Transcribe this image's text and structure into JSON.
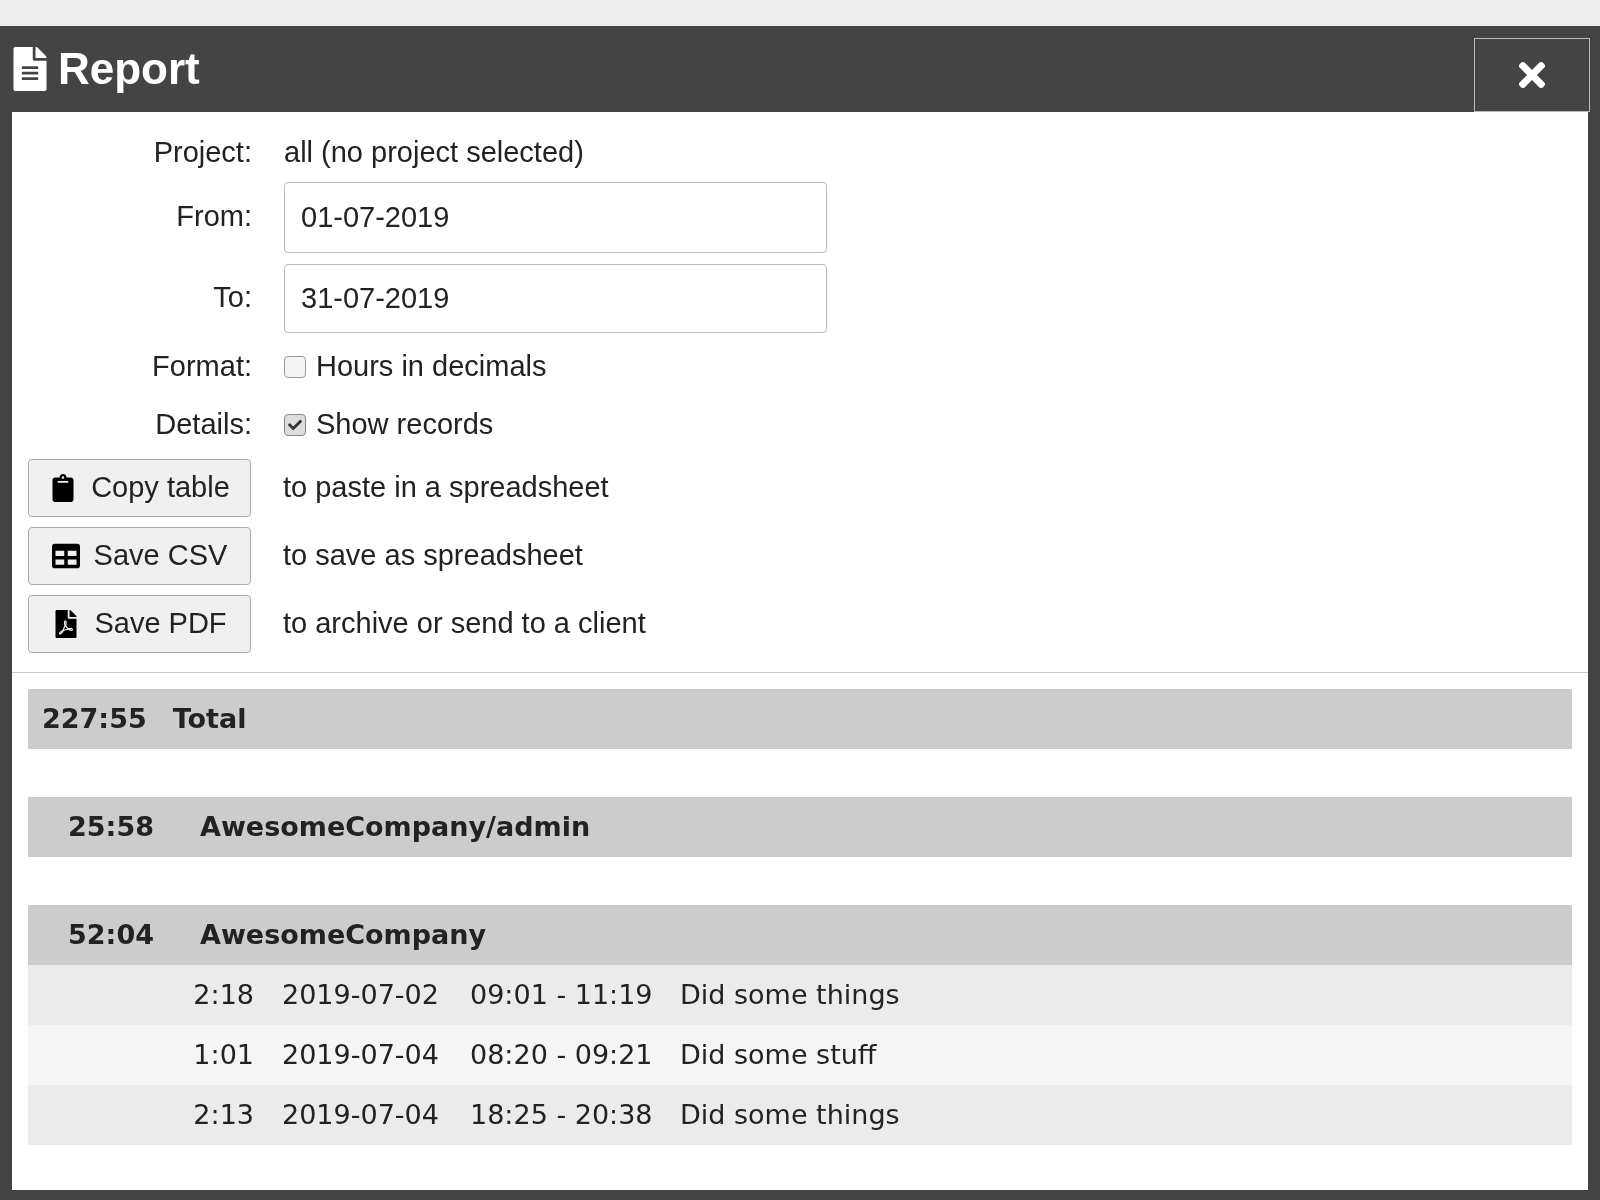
{
  "dialog": {
    "title": "Report"
  },
  "form": {
    "project": {
      "label": "Project:",
      "value": "all (no project selected)"
    },
    "from": {
      "label": "From:",
      "value": "01-07-2019"
    },
    "to": {
      "label": "To:",
      "value": "31-07-2019"
    },
    "format": {
      "label": "Format:",
      "option": "Hours in decimals",
      "checked": false
    },
    "details": {
      "label": "Details:",
      "option": "Show records",
      "checked": true
    }
  },
  "actions": [
    {
      "kind": "copy",
      "label": "Copy table",
      "description": "to paste in a spreadsheet"
    },
    {
      "kind": "csv",
      "label": "Save CSV",
      "description": "to save as spreadsheet"
    },
    {
      "kind": "pdf",
      "label": "Save PDF",
      "description": "to archive or send to a client"
    }
  ],
  "report": {
    "total": {
      "time": "227:55",
      "label": "Total"
    },
    "groups": [
      {
        "time": "25:58",
        "name": "AwesomeCompany/admin"
      },
      {
        "time": "52:04",
        "name": "AwesomeCompany",
        "records": [
          {
            "duration": "2:18",
            "date": "2019-07-02",
            "span": "09:01 - 11:19",
            "description": "Did some things"
          },
          {
            "duration": "1:01",
            "date": "2019-07-04",
            "span": "08:20 - 09:21",
            "description": "Did some stuff"
          },
          {
            "duration": "2:13",
            "date": "2019-07-04",
            "span": "18:25 - 20:38",
            "description": "Did some things"
          }
        ]
      }
    ]
  }
}
